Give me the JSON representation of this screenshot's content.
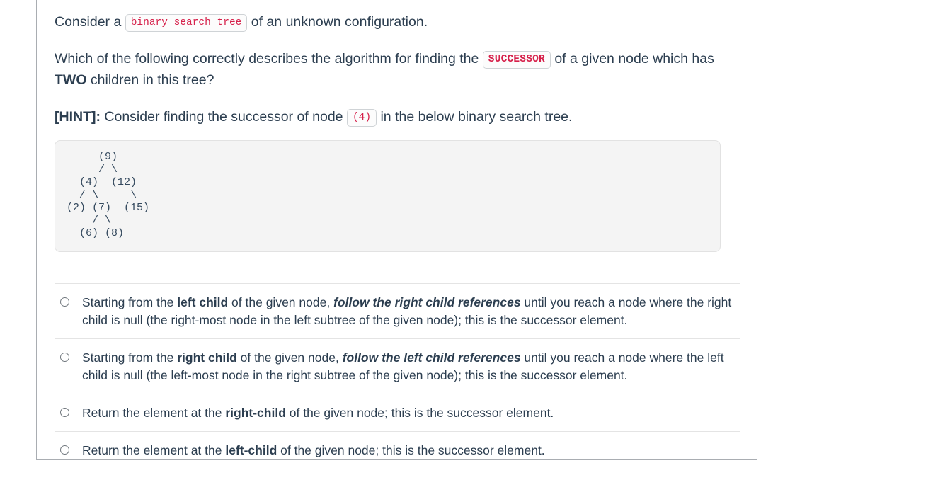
{
  "question": {
    "line1": {
      "before": "Consider a ",
      "code": "binary search tree",
      "after": " of an unknown configuration."
    },
    "line2": {
      "before": "Which of the following correctly describes the algorithm for finding the ",
      "code": "SUCCESSOR",
      "mid": " of a given node which has ",
      "bold": "TWO",
      "after": " children in this tree?"
    },
    "line3": {
      "hint_label": "[HINT]:",
      "before": " Consider finding the successor of node ",
      "code": "(4)",
      "after": " in the below binary search tree."
    }
  },
  "tree": {
    "ascii": "     (9)\n     / \\\n  (4)  (12)\n  / \\     \\\n(2) (7)  (15)\n    / \\\n  (6) (8)"
  },
  "options": [
    {
      "id": "option-a",
      "p1": "Starting from the ",
      "bold1": "left child",
      "p2": " of the given node, ",
      "emph": "follow the right child references",
      "p3": " until you reach a node where the right child is null (the right-most node in the left subtree of the given node); this is the successor element."
    },
    {
      "id": "option-b",
      "p1": "Starting from the ",
      "bold1": "right child",
      "p2": " of the given node, ",
      "emph": "follow the left child references",
      "p3": " until you reach a node where the left child is null (the left-most node in the right subtree of the given node); this is the successor element."
    },
    {
      "id": "option-c",
      "p1": "Return the element at the ",
      "bold1": "right-child",
      "p2": " of the given node; this is the successor element.",
      "emph": "",
      "p3": ""
    },
    {
      "id": "option-d",
      "p1": "Return the element at the ",
      "bold1": "left-child",
      "p2": " of the given node; this is the successor element.",
      "emph": "",
      "p3": ""
    }
  ],
  "colors": {
    "text": "#2c3e50",
    "code_red": "#d6204a",
    "tree_text": "#34495e",
    "card_border": "#a9adb2",
    "divider": "#e4e4e4",
    "code_bg": "#f4f4f4"
  }
}
